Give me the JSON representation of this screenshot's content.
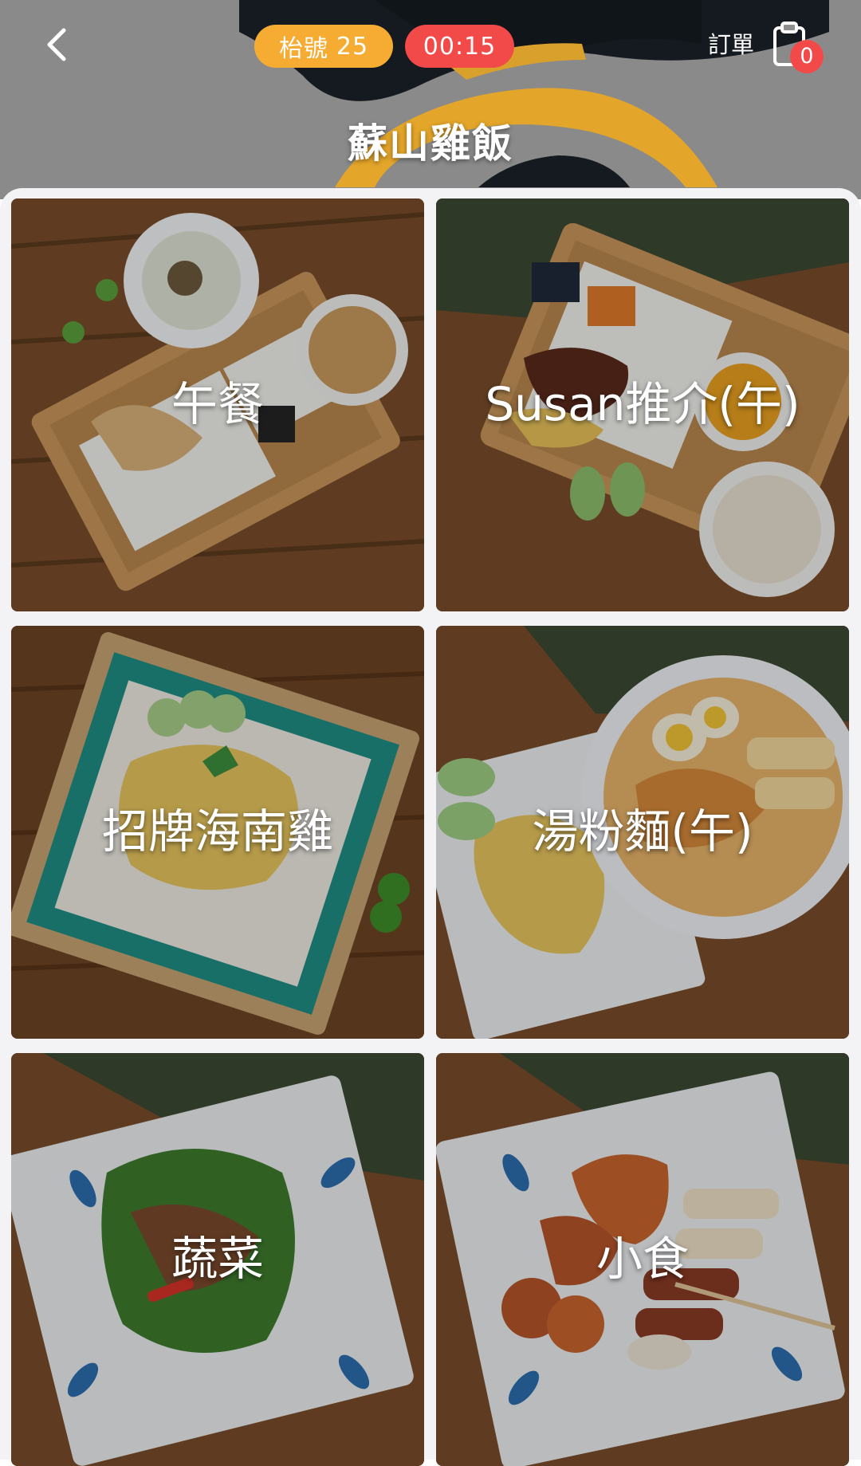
{
  "header": {
    "back_icon": "chevron-left-icon",
    "table_label": "枱號",
    "table_number": "25",
    "timer": "00:15",
    "orders_label": "訂單",
    "orders_icon": "clipboard-icon",
    "orders_count": "0",
    "title": "蘇山雞飯"
  },
  "categories": [
    {
      "label": "午餐"
    },
    {
      "label": "Susan推介(午)"
    },
    {
      "label": "招牌海南雞"
    },
    {
      "label": "湯粉麵(午)"
    },
    {
      "label": "蔬菜"
    },
    {
      "label": "小食"
    }
  ],
  "colors": {
    "table_badge": "#f6ac33",
    "timer_badge": "#f14a48",
    "count_badge": "#f14a48",
    "content_bg": "#f3f3f5"
  }
}
